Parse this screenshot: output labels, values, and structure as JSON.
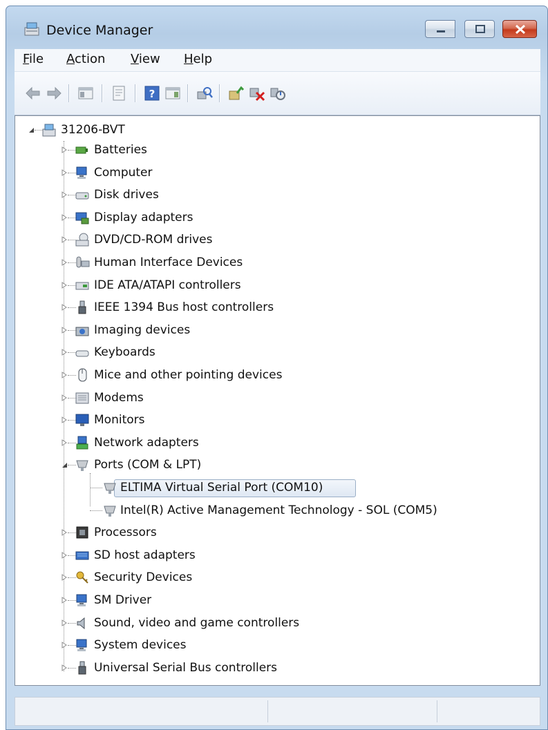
{
  "window": {
    "title": "Device Manager"
  },
  "menu": [
    "File",
    "Action",
    "View",
    "Help"
  ],
  "toolbar": {
    "buttons": [
      "back-icon",
      "forward-icon",
      "show-hide-console-tree-icon",
      "properties-icon",
      "help-icon",
      "action-pane-icon",
      "scan-hardware-icon",
      "update-driver-icon",
      "uninstall-icon",
      "disable-icon"
    ]
  },
  "tree": {
    "root": "31206-BVT",
    "categories": [
      {
        "label": "Batteries",
        "icon": "battery-icon"
      },
      {
        "label": "Computer",
        "icon": "computer-icon"
      },
      {
        "label": "Disk drives",
        "icon": "disk-drive-icon"
      },
      {
        "label": "Display adapters",
        "icon": "display-adapter-icon"
      },
      {
        "label": "DVD/CD-ROM drives",
        "icon": "dvd-drive-icon"
      },
      {
        "label": "Human Interface Devices",
        "icon": "hid-icon"
      },
      {
        "label": "IDE ATA/ATAPI controllers",
        "icon": "ide-controller-icon"
      },
      {
        "label": "IEEE 1394 Bus host controllers",
        "icon": "ieee1394-icon"
      },
      {
        "label": "Imaging devices",
        "icon": "camera-icon"
      },
      {
        "label": "Keyboards",
        "icon": "keyboard-icon"
      },
      {
        "label": "Mice and other pointing devices",
        "icon": "mouse-icon"
      },
      {
        "label": "Modems",
        "icon": "modem-icon"
      },
      {
        "label": "Monitors",
        "icon": "monitor-icon"
      },
      {
        "label": "Network adapters",
        "icon": "network-adapter-icon"
      },
      {
        "label": "Ports (COM & LPT)",
        "icon": "port-icon",
        "expanded": true,
        "children": [
          {
            "label": "ELTIMA Virtual Serial Port (COM10)",
            "icon": "port-icon",
            "selected": true
          },
          {
            "label": "Intel(R) Active Management Technology - SOL (COM5)",
            "icon": "port-icon"
          }
        ]
      },
      {
        "label": "Processors",
        "icon": "processor-icon"
      },
      {
        "label": "SD host adapters",
        "icon": "sd-adapter-icon"
      },
      {
        "label": "Security Devices",
        "icon": "key-icon"
      },
      {
        "label": "SM Driver",
        "icon": "computer-icon"
      },
      {
        "label": "Sound, video and game controllers",
        "icon": "speaker-icon"
      },
      {
        "label": "System devices",
        "icon": "computer-icon"
      },
      {
        "label": "Universal Serial Bus controllers",
        "icon": "usb-icon"
      }
    ]
  },
  "colors": {
    "titlebar": "#c3d9ef",
    "close_button": "#c43a1c",
    "selection": "#dfe8f3"
  }
}
